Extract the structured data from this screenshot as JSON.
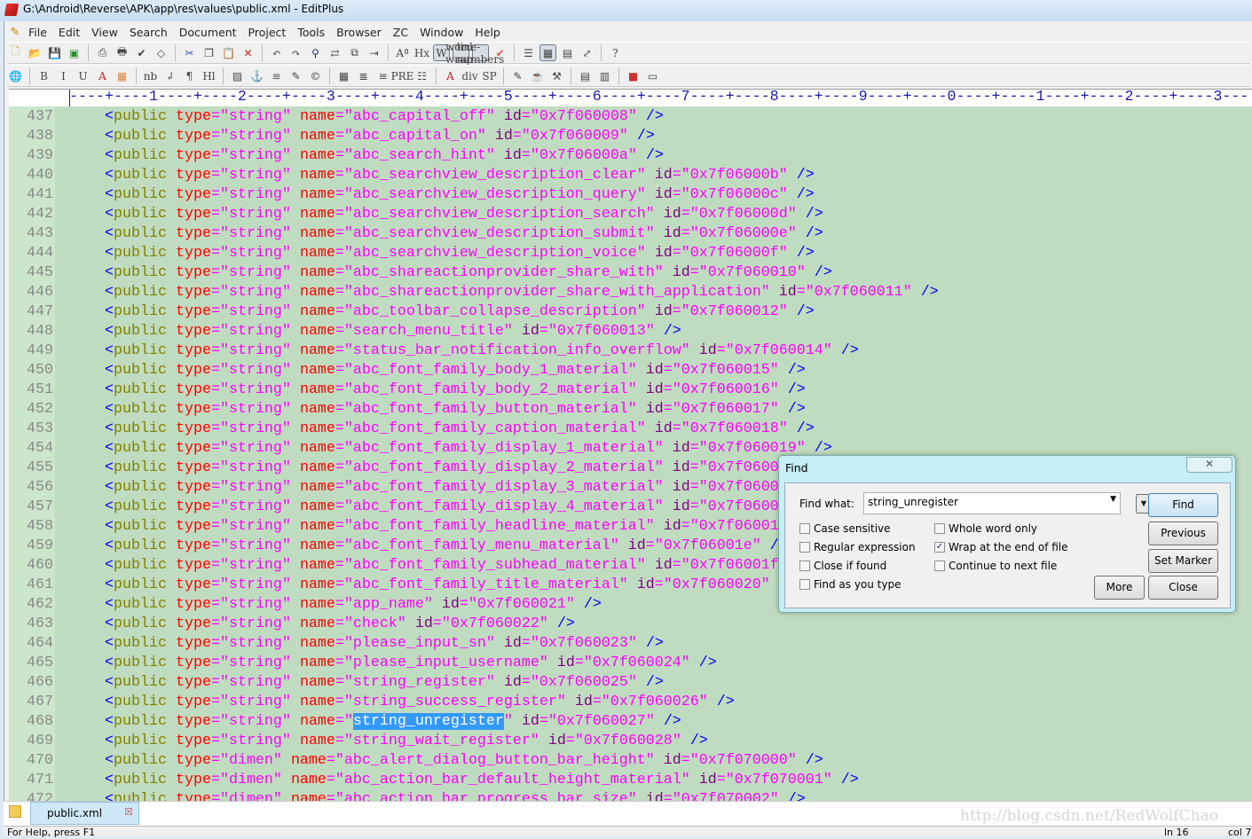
{
  "window": {
    "title": "G:\\Android\\Reverse\\APK\\app\\res\\values\\public.xml - EditPlus"
  },
  "menu": [
    "File",
    "Edit",
    "View",
    "Search",
    "Document",
    "Project",
    "Tools",
    "Browser",
    "ZC",
    "Window",
    "Help"
  ],
  "toolbar1": [
    "new-file",
    "open",
    "save",
    "save-all",
    "print-preview",
    "print",
    "spell-check",
    "browser-view",
    "cut",
    "copy",
    "paste",
    "delete",
    "undo",
    "redo",
    "find",
    "replace",
    "find-in-files",
    "go-to-line",
    "font",
    "Hx",
    "W",
    "word-wrap",
    "line-numbers",
    "check",
    "clip-window",
    "directory-window",
    "output-window",
    "full-screen",
    "help"
  ],
  "toolbar2": [
    "browser",
    "B",
    "I",
    "U",
    "A",
    "color",
    "nb",
    "↲",
    "¶",
    "Hl",
    "image",
    "anchor",
    "hr",
    "edit",
    "comment",
    "table",
    "align",
    "center",
    "PRE",
    "list",
    "font-tag",
    "div",
    "SP",
    "template",
    "coffee",
    "tools",
    "frame",
    "form",
    "color-picker",
    "window"
  ],
  "ruler": "----+----1----+----2----+----3----+----4----+----5----+----6----+----7----+----8----+----9----+----0----+----1----+----2----+----3---",
  "code": {
    "lines": [
      {
        "n": "437",
        "type": "string",
        "name": "abc_capital_off",
        "id": "0x7f060008"
      },
      {
        "n": "438",
        "type": "string",
        "name": "abc_capital_on",
        "id": "0x7f060009"
      },
      {
        "n": "439",
        "type": "string",
        "name": "abc_search_hint",
        "id": "0x7f06000a"
      },
      {
        "n": "440",
        "type": "string",
        "name": "abc_searchview_description_clear",
        "id": "0x7f06000b"
      },
      {
        "n": "441",
        "type": "string",
        "name": "abc_searchview_description_query",
        "id": "0x7f06000c"
      },
      {
        "n": "442",
        "type": "string",
        "name": "abc_searchview_description_search",
        "id": "0x7f06000d"
      },
      {
        "n": "443",
        "type": "string",
        "name": "abc_searchview_description_submit",
        "id": "0x7f06000e"
      },
      {
        "n": "444",
        "type": "string",
        "name": "abc_searchview_description_voice",
        "id": "0x7f06000f"
      },
      {
        "n": "445",
        "type": "string",
        "name": "abc_shareactionprovider_share_with",
        "id": "0x7f060010"
      },
      {
        "n": "446",
        "type": "string",
        "name": "abc_shareactionprovider_share_with_application",
        "id": "0x7f060011"
      },
      {
        "n": "447",
        "type": "string",
        "name": "abc_toolbar_collapse_description",
        "id": "0x7f060012"
      },
      {
        "n": "448",
        "type": "string",
        "name": "search_menu_title",
        "id": "0x7f060013"
      },
      {
        "n": "449",
        "type": "string",
        "name": "status_bar_notification_info_overflow",
        "id": "0x7f060014"
      },
      {
        "n": "450",
        "type": "string",
        "name": "abc_font_family_body_1_material",
        "id": "0x7f060015"
      },
      {
        "n": "451",
        "type": "string",
        "name": "abc_font_family_body_2_material",
        "id": "0x7f060016"
      },
      {
        "n": "452",
        "type": "string",
        "name": "abc_font_family_button_material",
        "id": "0x7f060017"
      },
      {
        "n": "453",
        "type": "string",
        "name": "abc_font_family_caption_material",
        "id": "0x7f060018"
      },
      {
        "n": "454",
        "type": "string",
        "name": "abc_font_family_display_1_material",
        "id": "0x7f060019"
      },
      {
        "n": "455",
        "type": "string",
        "name": "abc_font_family_display_2_material",
        "id": "0x7f0600"
      },
      {
        "n": "456",
        "type": "string",
        "name": "abc_font_family_display_3_material",
        "id": "0x7f0600"
      },
      {
        "n": "457",
        "type": "string",
        "name": "abc_font_family_display_4_material",
        "id": "0x7f0600"
      },
      {
        "n": "458",
        "type": "string",
        "name": "abc_font_family_headline_material",
        "id": "0x7f06001"
      },
      {
        "n": "459",
        "type": "string",
        "name": "abc_font_family_menu_material",
        "id": "0x7f06001e"
      },
      {
        "n": "460",
        "type": "string",
        "name": "abc_font_family_subhead_material",
        "id": "0x7f06001f"
      },
      {
        "n": "461",
        "type": "string",
        "name": "abc_font_family_title_material",
        "id": "0x7f060020"
      },
      {
        "n": "462",
        "type": "string",
        "name": "app_name",
        "id": "0x7f060021"
      },
      {
        "n": "463",
        "type": "string",
        "name": "check",
        "id": "0x7f060022"
      },
      {
        "n": "464",
        "type": "string",
        "name": "please_input_sn",
        "id": "0x7f060023"
      },
      {
        "n": "465",
        "type": "string",
        "name": "please_input_username",
        "id": "0x7f060024"
      },
      {
        "n": "466",
        "type": "string",
        "name": "string_register",
        "id": "0x7f060025"
      },
      {
        "n": "467",
        "type": "string",
        "name": "string_success_register",
        "id": "0x7f060026"
      },
      {
        "n": "468",
        "type": "string",
        "name": "string_unregister",
        "id": "0x7f060027",
        "selected": true
      },
      {
        "n": "469",
        "type": "string",
        "name": "string_wait_register",
        "id": "0x7f060028"
      },
      {
        "n": "470",
        "type": "dimen",
        "name": "abc_alert_dialog_button_bar_height",
        "id": "0x7f070000"
      },
      {
        "n": "471",
        "type": "dimen",
        "name": "abc_action_bar_default_height_material",
        "id": "0x7f070001"
      },
      {
        "n": "472",
        "type": "dimen",
        "name": "abc_action_bar_progress_bar_size",
        "id": "0x7f070002"
      }
    ]
  },
  "tabs": [
    {
      "label": "public.xml",
      "active": true
    }
  ],
  "watermark": "http://blog.csdn.net/RedWolfChao",
  "status": {
    "help": "For Help, press F1",
    "line": "ln 16",
    "col": "col 7"
  },
  "find_dialog": {
    "title": "Find",
    "close_glyph": "✕",
    "find_what_label": "Find what:",
    "find_what_value": "string_unregister",
    "options": [
      {
        "label": "Case sensitive",
        "checked": false
      },
      {
        "label": "Regular expression",
        "checked": false
      },
      {
        "label": "Close if found",
        "checked": false
      },
      {
        "label": "Find as you type",
        "checked": false
      },
      {
        "label": "Whole word only",
        "checked": false
      },
      {
        "label": "Wrap at the end of file",
        "checked": true
      },
      {
        "label": "Continue to next file",
        "checked": false
      }
    ],
    "buttons": {
      "find": "Find",
      "previous": "Previous",
      "set_marker": "Set Marker",
      "more": "More",
      "close": "Close"
    }
  },
  "colors": {
    "editor_bg": "#c0dcc0",
    "tag": "#0000ff",
    "element": "#808000",
    "attr": "#ff0000",
    "value": "#ff00ff",
    "id_attr": "#800080",
    "selection": "#3399ff"
  }
}
